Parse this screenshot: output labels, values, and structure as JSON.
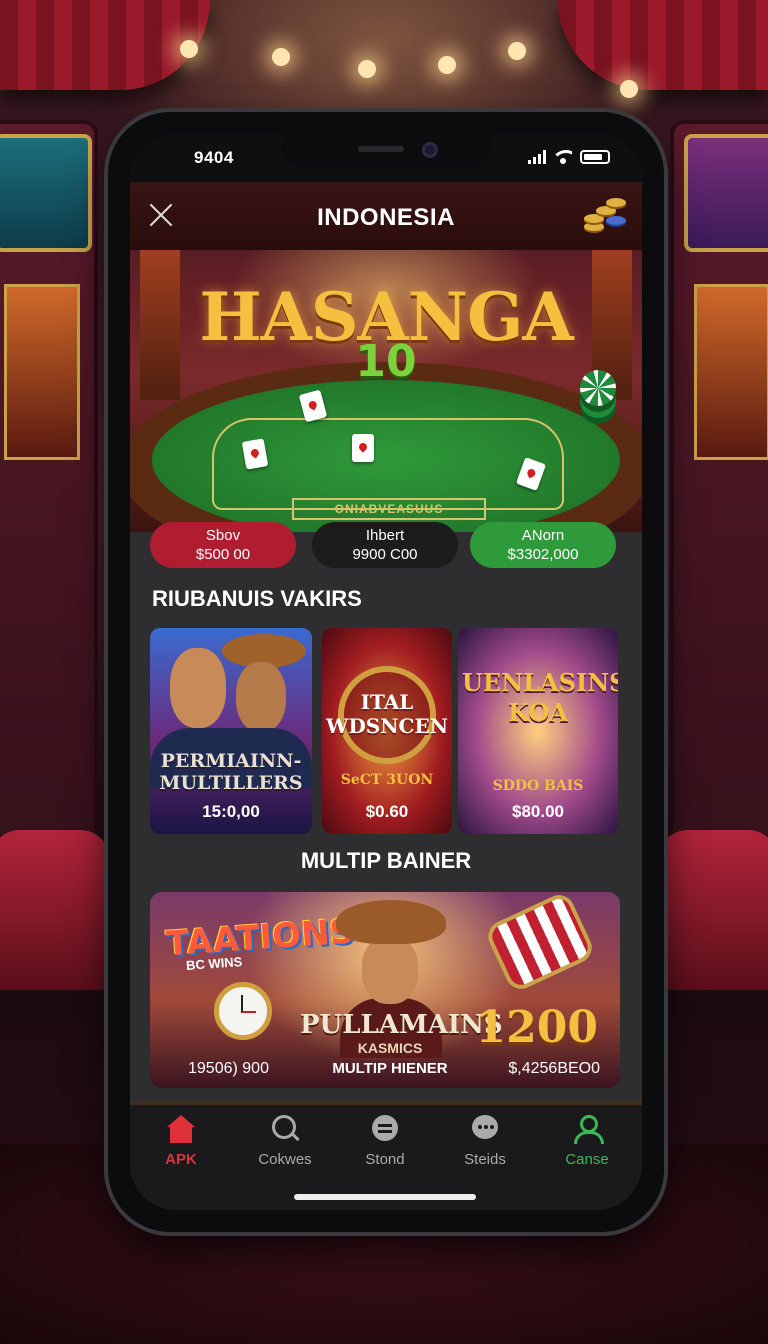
{
  "status": {
    "time": "9404"
  },
  "appbar": {
    "title": "INDONESIA"
  },
  "hero": {
    "logo": "HASANGA",
    "logo_sub": "10",
    "table_label": "ONIABVEASUUS",
    "tags": [
      {
        "name": "Sbov",
        "value": "$500 00"
      },
      {
        "name": "Ihbert",
        "value": "9900 C00"
      },
      {
        "name": "ANorn",
        "value": "$3302,000"
      }
    ]
  },
  "section1": {
    "title": "RIUBANUIS VAKIRS",
    "tiles": [
      {
        "title": "PERMIAINN-MULTILLERS",
        "price": "15:0,00"
      },
      {
        "title": "ITAL WDSNCEN",
        "subtitle": "SeCT 3UON",
        "price": "$0.60"
      },
      {
        "title": "UENLASINS KOA",
        "subtitle": "SDDO BAIS",
        "price": "$80.00"
      }
    ]
  },
  "section2": {
    "title": "MULTIP BAINER",
    "banner": {
      "title": "TAATIONS",
      "subtitle": "BC WINS",
      "name": "PULLAMAINS",
      "name2": "KASMICS",
      "multiplier": "MULTIP HIENER",
      "left_value": "19506) 900",
      "big_value": "1200",
      "right_value": "$,4256BEO0"
    }
  },
  "tabbar": {
    "items": [
      {
        "label": "APK"
      },
      {
        "label": "Cokwes"
      },
      {
        "label": "Stond"
      },
      {
        "label": "Steids"
      },
      {
        "label": "Canse"
      }
    ]
  },
  "colors": {
    "accent_red": "#b01c30",
    "accent_green": "#2e9a3a",
    "gold": "#f5c040"
  }
}
